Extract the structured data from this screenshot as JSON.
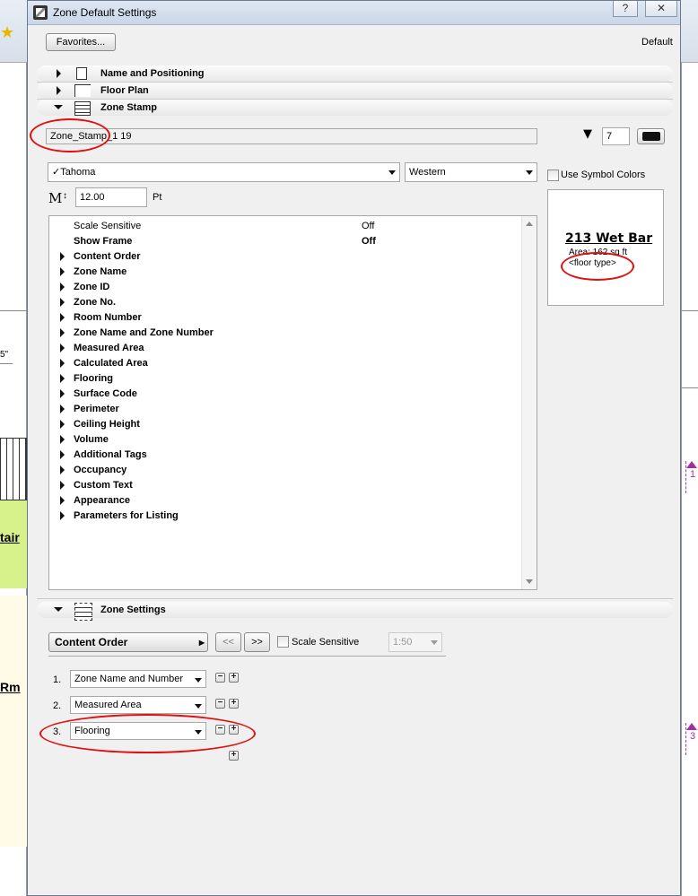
{
  "window": {
    "title": "Zone Default Settings",
    "help_label": "?",
    "close_label": "✕"
  },
  "toolbar": {
    "favorites_label": "Favorites...",
    "default_label": "Default"
  },
  "sections": [
    {
      "label": "Name and Positioning",
      "expanded": false
    },
    {
      "label": "Floor Plan",
      "expanded": false
    },
    {
      "label": "Zone Stamp",
      "expanded": true
    },
    {
      "label": "Zone Settings",
      "expanded": true
    }
  ],
  "zone_stamp": {
    "library_part": "Zone_Stamp_1 19",
    "pen_value": "7",
    "font_name": "Tahoma",
    "font_check": "✓",
    "script": "Western",
    "use_symbol_colors_label": "Use Symbol Colors",
    "font_size": "12.00",
    "font_size_unit": "Pt",
    "font_size_icon": "M",
    "parameters": [
      {
        "name": "Scale Sensitive",
        "value": "Off",
        "expandable": false,
        "bold": false
      },
      {
        "name": "Show Frame",
        "value": "Off",
        "expandable": false,
        "bold": true
      },
      {
        "name": "Content Order",
        "value": "",
        "expandable": true,
        "bold": true
      },
      {
        "name": "Zone Name",
        "value": "",
        "expandable": true,
        "bold": true
      },
      {
        "name": "Zone ID",
        "value": "",
        "expandable": true,
        "bold": true
      },
      {
        "name": "Zone No.",
        "value": "",
        "expandable": true,
        "bold": true
      },
      {
        "name": "Room Number",
        "value": "",
        "expandable": true,
        "bold": true
      },
      {
        "name": "Zone Name and Zone Number",
        "value": "",
        "expandable": true,
        "bold": true
      },
      {
        "name": "Measured Area",
        "value": "",
        "expandable": true,
        "bold": true
      },
      {
        "name": "Calculated Area",
        "value": "",
        "expandable": true,
        "bold": true
      },
      {
        "name": "Flooring",
        "value": "",
        "expandable": true,
        "bold": true
      },
      {
        "name": "Surface Code",
        "value": "",
        "expandable": true,
        "bold": true
      },
      {
        "name": "Perimeter",
        "value": "",
        "expandable": true,
        "bold": true
      },
      {
        "name": "Ceiling Height",
        "value": "",
        "expandable": true,
        "bold": true
      },
      {
        "name": "Volume",
        "value": "",
        "expandable": true,
        "bold": true
      },
      {
        "name": "Additional Tags",
        "value": "",
        "expandable": true,
        "bold": true
      },
      {
        "name": "Occupancy",
        "value": "",
        "expandable": true,
        "bold": true
      },
      {
        "name": "Custom Text",
        "value": "",
        "expandable": true,
        "bold": true
      },
      {
        "name": "Appearance",
        "value": "",
        "expandable": true,
        "bold": true
      },
      {
        "name": "Parameters for Listing",
        "value": "",
        "expandable": true,
        "bold": true
      }
    ],
    "preview": {
      "title": "213 Wet Bar",
      "area": "Area: 162 sq ft",
      "floor": "<floor type>"
    }
  },
  "zone_settings": {
    "page_label": "Content Order",
    "prev_label": "<<",
    "next_label": ">>",
    "scale_sensitive_label": "Scale Sensitive",
    "scale_value": "1:50",
    "order_items": [
      {
        "index": "1.",
        "value": "Zone Name and Number"
      },
      {
        "index": "2.",
        "value": "Measured Area"
      },
      {
        "index": "3.",
        "value": "Flooring"
      }
    ],
    "minus_label": "−",
    "plus_label": "+"
  },
  "background": {
    "left_label_1": "tair",
    "left_label_2": "Rm",
    "left_fraction": "5\"",
    "marker_1": "1",
    "marker_2": "3"
  },
  "colors": {
    "annotation": "#e01010",
    "marker": "#a030a0"
  }
}
